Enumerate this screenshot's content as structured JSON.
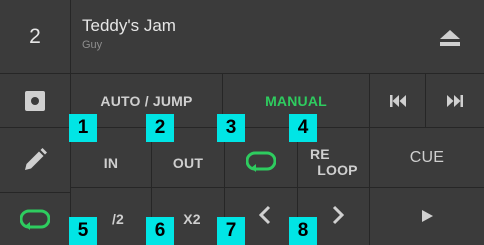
{
  "deck": {
    "number": "2"
  },
  "track": {
    "title": "Teddy's Jam",
    "artist": "Guy"
  },
  "modes": {
    "auto_jump": "AUTO / JUMP",
    "manual": "MANUAL"
  },
  "buttons": {
    "in": "IN",
    "out": "OUT",
    "reloop_line1": "RE",
    "reloop_line2": "LOOP",
    "cue": "CUE",
    "half": "/2",
    "double": "X2"
  },
  "badges": [
    "1",
    "2",
    "3",
    "4",
    "5",
    "6",
    "7",
    "8"
  ],
  "colors": {
    "accent_green": "#2ecc5f",
    "badge_cyan": "#00e5e5",
    "panel": "#3b3b3b",
    "background": "#262626"
  },
  "icons": {
    "eject": "eject-icon",
    "record": "record-icon",
    "edit": "pencil-icon",
    "loop_side": "loop-icon",
    "loop_toggle": "loop-icon",
    "skip_back": "skip-back-icon",
    "skip_forward": "skip-forward-icon",
    "loop_move_back": "chevron-left-icon",
    "loop_move_forward": "chevron-right-icon",
    "play": "play-icon"
  }
}
